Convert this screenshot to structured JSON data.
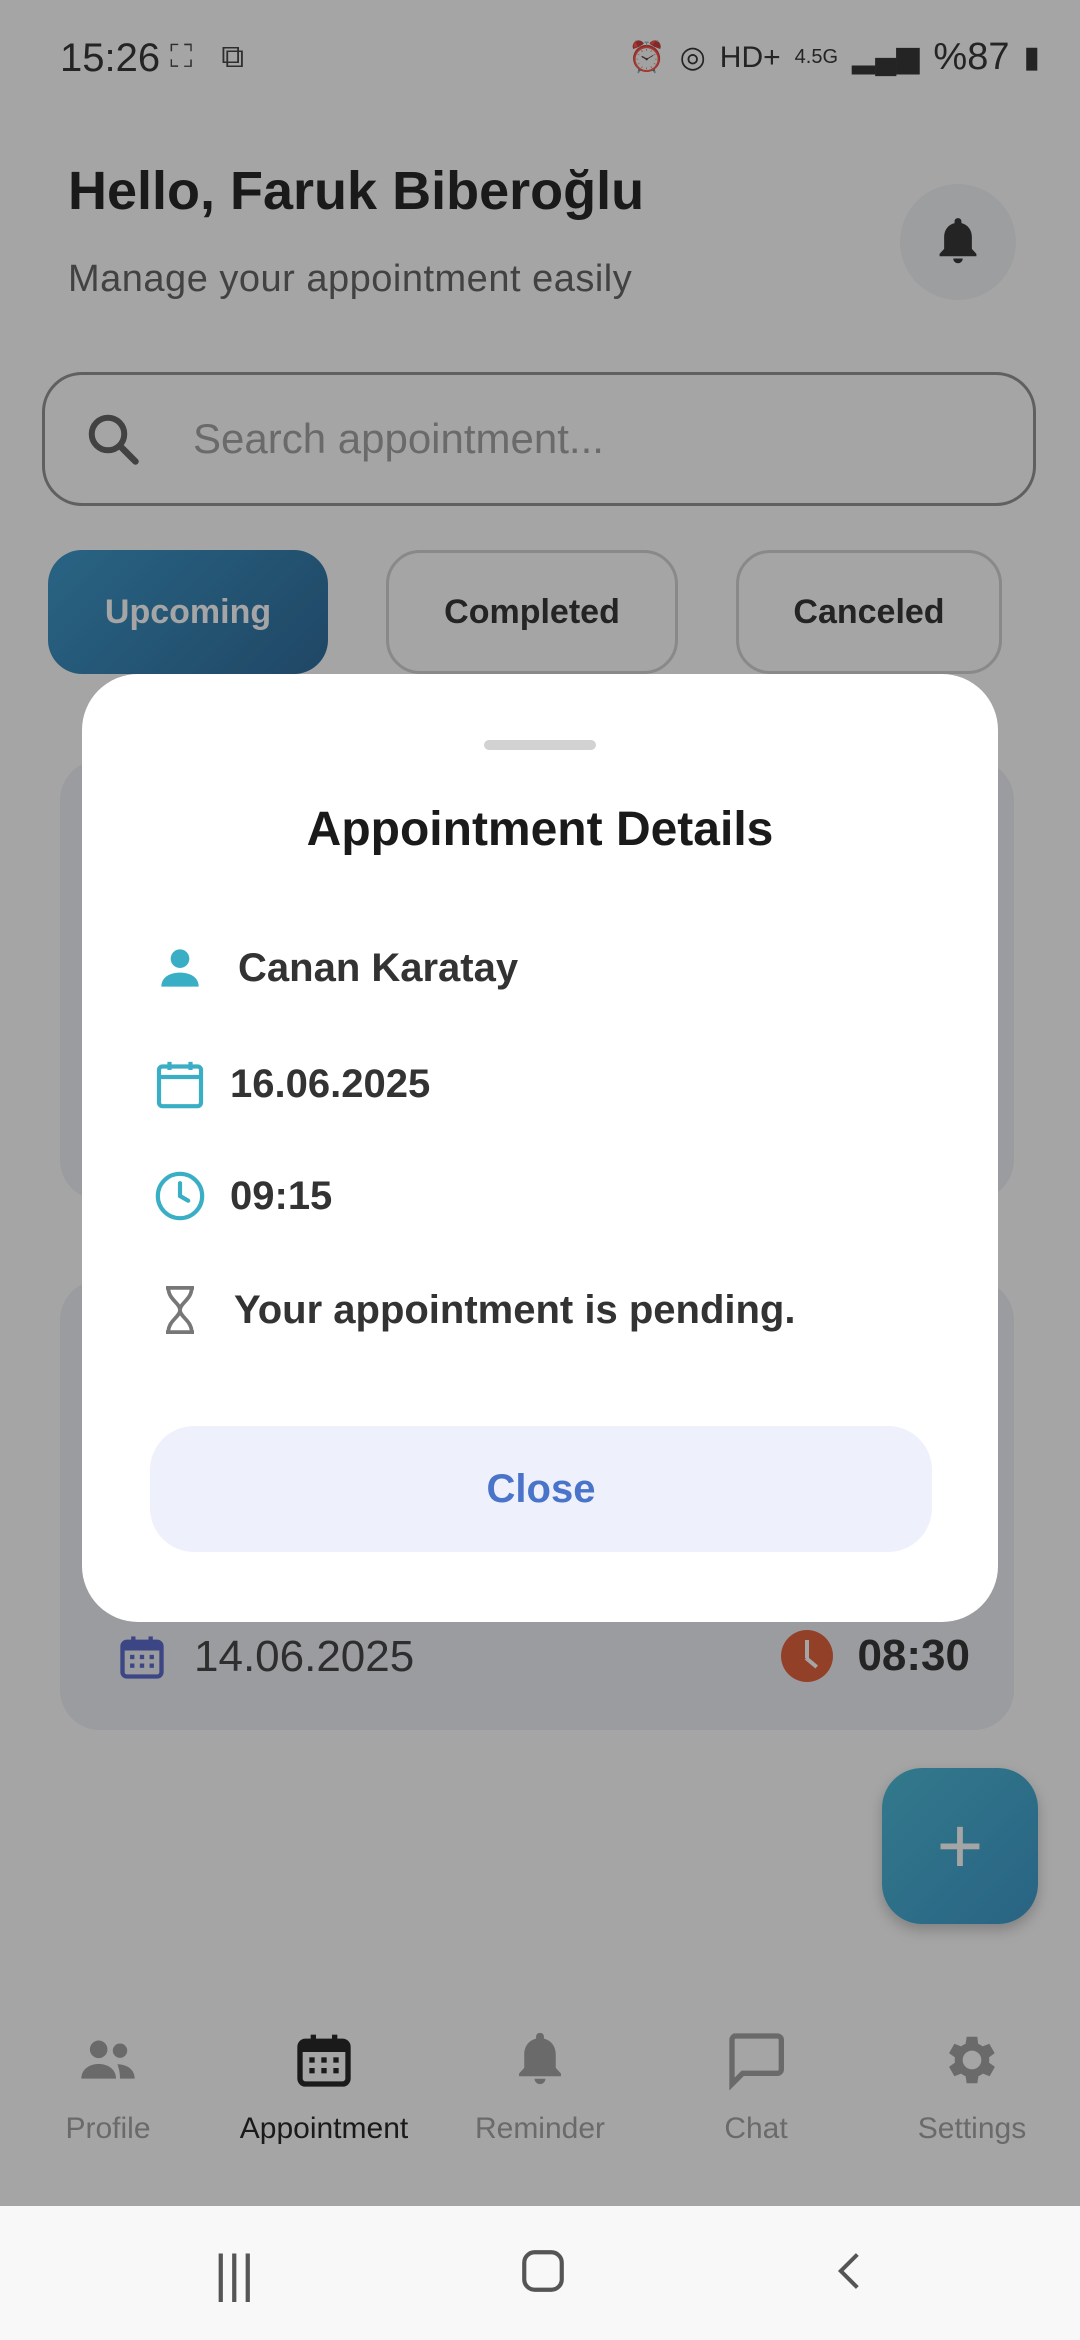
{
  "status_bar": {
    "time": "15:26",
    "network": "4.5G",
    "battery": "%87"
  },
  "header": {
    "greeting": "Hello, Faruk Biberoğlu",
    "subtitle": "Manage your appointment easily"
  },
  "search": {
    "placeholder": "Search appointment..."
  },
  "tabs": [
    {
      "label": "Upcoming",
      "active": true
    },
    {
      "label": "Completed",
      "active": false
    },
    {
      "label": "Canceled",
      "active": false
    }
  ],
  "background_card": {
    "date": "14.06.2025",
    "time": "08:30"
  },
  "fab": {
    "icon": "plus-icon"
  },
  "bottom_nav": [
    {
      "label": "Profile",
      "icon": "people-icon",
      "active": false
    },
    {
      "label": "Appointment",
      "icon": "calendar-icon",
      "active": true
    },
    {
      "label": "Reminder",
      "icon": "bell-icon",
      "active": false
    },
    {
      "label": "Chat",
      "icon": "chat-icon",
      "active": false
    },
    {
      "label": "Settings",
      "icon": "gear-icon",
      "active": false
    }
  ],
  "dialog": {
    "title": "Appointment Details",
    "name": "Canan Karatay",
    "date": "16.06.2025",
    "time": "09:15",
    "status": "Your appointment is pending.",
    "close_label": "Close"
  },
  "colors": {
    "accent": "#2a8fc6",
    "teal_icon": "#3aaec4",
    "close_text": "#4a74c9",
    "alert_red": "#e0522a"
  }
}
